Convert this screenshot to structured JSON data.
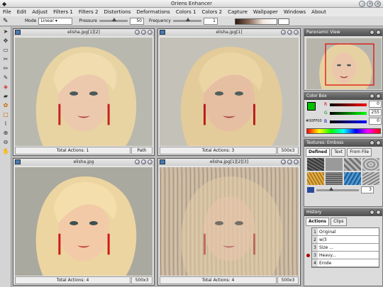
{
  "app": {
    "title": "Oriens Enhancer"
  },
  "menu": [
    "File",
    "Edit",
    "Adjust",
    "Filters 1",
    "Filters 2",
    "Distortions",
    "Deformations",
    "Colors 1",
    "Colors 2",
    "Capture",
    "Wallpaper",
    "Windows",
    "About"
  ],
  "toolbar": {
    "mode_label": "Mode",
    "mode_value": "Linear",
    "pressure_label": "Pressure",
    "pressure_value": "50",
    "frequency_label": "Frequency",
    "frequency_value": "1"
  },
  "windows": [
    {
      "title": "elisha.jpg[1][2]",
      "actions": "Total Actions: 1",
      "extra": "Path"
    },
    {
      "title": "elisha.jpg[1]",
      "actions": "Total Actions: 3",
      "extra": "500x3"
    },
    {
      "title": "elisha.jpg",
      "actions": "Total Actions: 4",
      "extra": "500x3"
    },
    {
      "title": "elisha.jpg[1][2][3]",
      "actions": "Total Actions: 4",
      "extra": "500x3"
    }
  ],
  "panorama": {
    "title": "Panoramic View"
  },
  "colorbox": {
    "title": "Color Box",
    "r_label": "R",
    "r_value": "0",
    "g_label": "G",
    "g_value": "255",
    "b_label": "B",
    "b_value": "0",
    "hex": "#00FF00",
    "fg_color": "#00c000",
    "bg_color": "#e00000"
  },
  "textures": {
    "title": "Textures: Emboss",
    "tabs": [
      "Defined",
      "Text",
      "From File"
    ],
    "count": "3"
  },
  "history": {
    "title": "History",
    "tabs": [
      "Actions",
      "Clips"
    ],
    "items": [
      {
        "num": "1",
        "label": "Original"
      },
      {
        "num": "2",
        "label": "w/3"
      },
      {
        "num": "3",
        "label": "Size ..."
      },
      {
        "num": "3",
        "label": "Heavy..."
      },
      {
        "num": "4",
        "label": "Erode"
      }
    ]
  }
}
